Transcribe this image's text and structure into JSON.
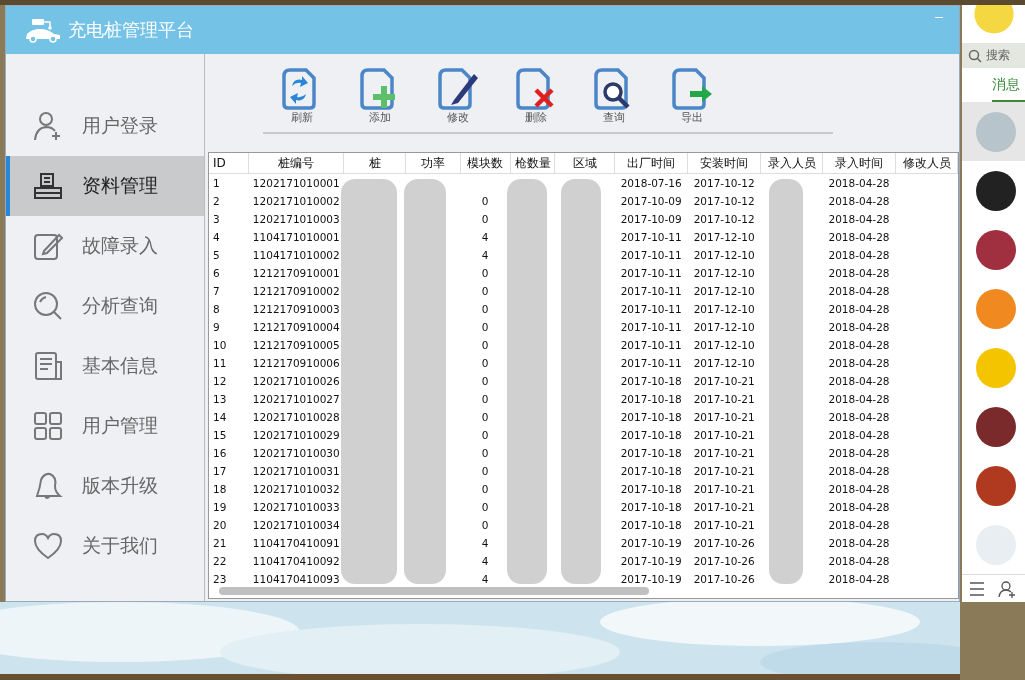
{
  "window": {
    "title": "充电桩管理平台",
    "minimize": "–"
  },
  "sidebar": {
    "items": [
      {
        "label": "用户登录",
        "kind": "user",
        "selected": false
      },
      {
        "label": "资料管理",
        "kind": "printer",
        "selected": true
      },
      {
        "label": "故障录入",
        "kind": "edit",
        "selected": false
      },
      {
        "label": "分析查询",
        "kind": "search",
        "selected": false
      },
      {
        "label": "基本信息",
        "kind": "doc",
        "selected": false
      },
      {
        "label": "用户管理",
        "kind": "grid",
        "selected": false
      },
      {
        "label": "版本升级",
        "kind": "bell",
        "selected": false
      },
      {
        "label": "关于我们",
        "kind": "heart",
        "selected": false
      }
    ]
  },
  "toolbar": [
    {
      "label": "刷新",
      "kind": "refresh"
    },
    {
      "label": "添加",
      "kind": "add"
    },
    {
      "label": "修改",
      "kind": "edit"
    },
    {
      "label": "删除",
      "kind": "delete"
    },
    {
      "label": "查询",
      "kind": "search"
    },
    {
      "label": "导出",
      "kind": "export"
    }
  ],
  "table": {
    "columns": [
      "ID",
      "桩编号",
      "桩",
      "功率",
      "模块数",
      "枪数量",
      "区域",
      "出厂时间",
      "安装时间",
      "录入人员",
      "录入时间",
      "修改人员"
    ],
    "rows": [
      {
        "id": "1",
        "pile_no": "1202171010001",
        "factory_date": "2018-07-16",
        "install_date": "2017-10-12",
        "entry_date": "2018-04-28"
      },
      {
        "id": "2",
        "pile_no": "1202171010002",
        "modules": "0",
        "factory_date": "2017-10-09",
        "install_date": "2017-10-12",
        "entry_date": "2018-04-28"
      },
      {
        "id": "3",
        "pile_no": "1202171010003",
        "modules": "0",
        "factory_date": "2017-10-09",
        "install_date": "2017-10-12",
        "entry_date": "2018-04-28"
      },
      {
        "id": "4",
        "pile_no": "1104171010001",
        "modules": "4",
        "factory_date": "2017-10-11",
        "install_date": "2017-12-10",
        "entry_date": "2018-04-28"
      },
      {
        "id": "5",
        "pile_no": "1104171010002",
        "modules": "4",
        "factory_date": "2017-10-11",
        "install_date": "2017-12-10",
        "entry_date": "2018-04-28"
      },
      {
        "id": "6",
        "pile_no": "1212170910001",
        "modules": "0",
        "factory_date": "2017-10-11",
        "install_date": "2017-12-10",
        "entry_date": "2018-04-28"
      },
      {
        "id": "7",
        "pile_no": "1212170910002",
        "modules": "0",
        "factory_date": "2017-10-11",
        "install_date": "2017-12-10",
        "entry_date": "2018-04-28"
      },
      {
        "id": "8",
        "pile_no": "1212170910003",
        "modules": "0",
        "factory_date": "2017-10-11",
        "install_date": "2017-12-10",
        "entry_date": "2018-04-28"
      },
      {
        "id": "9",
        "pile_no": "1212170910004",
        "modules": "0",
        "factory_date": "2017-10-11",
        "install_date": "2017-12-10",
        "entry_date": "2018-04-28"
      },
      {
        "id": "10",
        "pile_no": "1212170910005",
        "modules": "0",
        "factory_date": "2017-10-11",
        "install_date": "2017-12-10",
        "entry_date": "2018-04-28"
      },
      {
        "id": "11",
        "pile_no": "1212170910006",
        "modules": "0",
        "factory_date": "2017-10-11",
        "install_date": "2017-12-10",
        "entry_date": "2018-04-28"
      },
      {
        "id": "12",
        "pile_no": "1202171010026",
        "modules": "0",
        "factory_date": "2017-10-18",
        "install_date": "2017-10-21",
        "entry_date": "2018-04-28"
      },
      {
        "id": "13",
        "pile_no": "1202171010027",
        "modules": "0",
        "factory_date": "2017-10-18",
        "install_date": "2017-10-21",
        "entry_date": "2018-04-28"
      },
      {
        "id": "14",
        "pile_no": "1202171010028",
        "modules": "0",
        "factory_date": "2017-10-18",
        "install_date": "2017-10-21",
        "entry_date": "2018-04-28"
      },
      {
        "id": "15",
        "pile_no": "1202171010029",
        "modules": "0",
        "factory_date": "2017-10-18",
        "install_date": "2017-10-21",
        "entry_date": "2018-04-28"
      },
      {
        "id": "16",
        "pile_no": "1202171010030",
        "modules": "0",
        "factory_date": "2017-10-18",
        "install_date": "2017-10-21",
        "entry_date": "2018-04-28"
      },
      {
        "id": "17",
        "pile_no": "1202171010031",
        "modules": "0",
        "factory_date": "2017-10-18",
        "install_date": "2017-10-21",
        "entry_date": "2018-04-28"
      },
      {
        "id": "18",
        "pile_no": "1202171010032",
        "modules": "0",
        "factory_date": "2017-10-18",
        "install_date": "2017-10-21",
        "entry_date": "2018-04-28"
      },
      {
        "id": "19",
        "pile_no": "1202171010033",
        "modules": "0",
        "factory_date": "2017-10-18",
        "install_date": "2017-10-21",
        "entry_date": "2018-04-28"
      },
      {
        "id": "20",
        "pile_no": "1202171010034",
        "modules": "0",
        "factory_date": "2017-10-18",
        "install_date": "2017-10-21",
        "entry_date": "2018-04-28"
      },
      {
        "id": "21",
        "pile_no": "1104170410091",
        "modules": "4",
        "factory_date": "2017-10-19",
        "install_date": "2017-10-26",
        "entry_date": "2018-04-28"
      },
      {
        "id": "22",
        "pile_no": "1104170410092",
        "modules": "4",
        "factory_date": "2017-10-19",
        "install_date": "2017-10-26",
        "entry_date": "2018-04-28"
      },
      {
        "id": "23",
        "pile_no": "1104170410093",
        "modules": "4",
        "factory_date": "2017-10-19",
        "install_date": "2017-10-26",
        "entry_date": "2018-04-28"
      }
    ]
  },
  "side_panel": {
    "search": {
      "placeholder": "搜索"
    },
    "tab": "消息",
    "chats": [
      {
        "selected": true,
        "color": "#b8c4cc"
      },
      {
        "selected": false,
        "color": "#222222"
      },
      {
        "selected": false,
        "color": "#a03040"
      },
      {
        "selected": false,
        "color": "#f08a20"
      },
      {
        "selected": false,
        "color": "#f5c400"
      },
      {
        "selected": false,
        "color": "#7a2a2a"
      },
      {
        "selected": false,
        "color": "#b03a20"
      },
      {
        "selected": false,
        "color": "#e8eef2"
      }
    ]
  }
}
